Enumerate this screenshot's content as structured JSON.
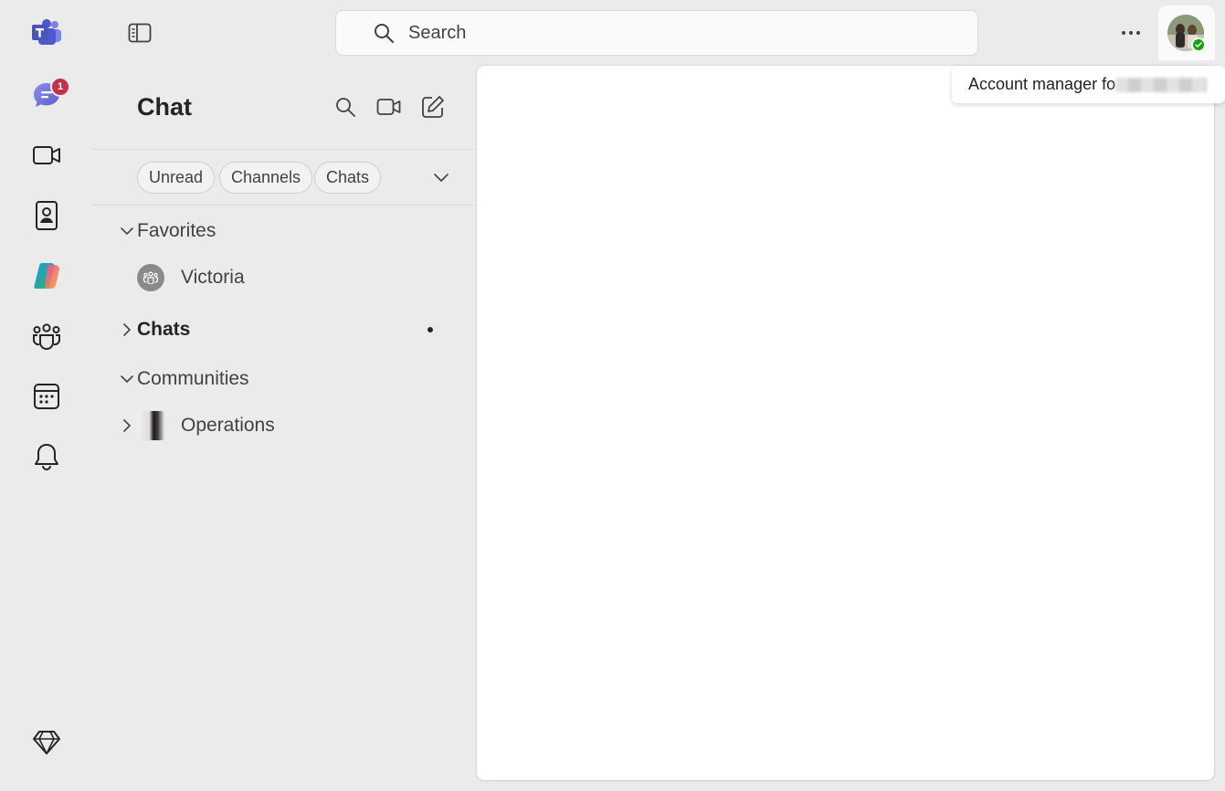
{
  "rail": {
    "items": [
      {
        "name": "teams-logo-icon"
      },
      {
        "name": "chat-icon",
        "badge": "1"
      },
      {
        "name": "meet-icon"
      },
      {
        "name": "people-icon"
      },
      {
        "name": "copilot-icon"
      },
      {
        "name": "communities-icon"
      },
      {
        "name": "calendar-icon"
      },
      {
        "name": "activity-bell-icon"
      },
      {
        "name": "premium-diamond-icon"
      }
    ],
    "chat_badge": "1"
  },
  "search": {
    "placeholder": "Search"
  },
  "account": {
    "tooltip": "Account manager fo",
    "status": "available",
    "status_color": "#13a10e"
  },
  "chat_pane": {
    "title": "Chat",
    "filters": [
      "Unread",
      "Channels",
      "Chats"
    ],
    "favorites": {
      "label": "Favorites",
      "items": [
        {
          "label": "Victoria"
        }
      ]
    },
    "chats": {
      "label": "Chats"
    },
    "communities": {
      "label": "Communities",
      "items": [
        {
          "label": "Operations"
        }
      ]
    }
  },
  "colors": {
    "brand": "#5b5fc7",
    "badge": "#c4314b",
    "background": "#ebebeb"
  }
}
